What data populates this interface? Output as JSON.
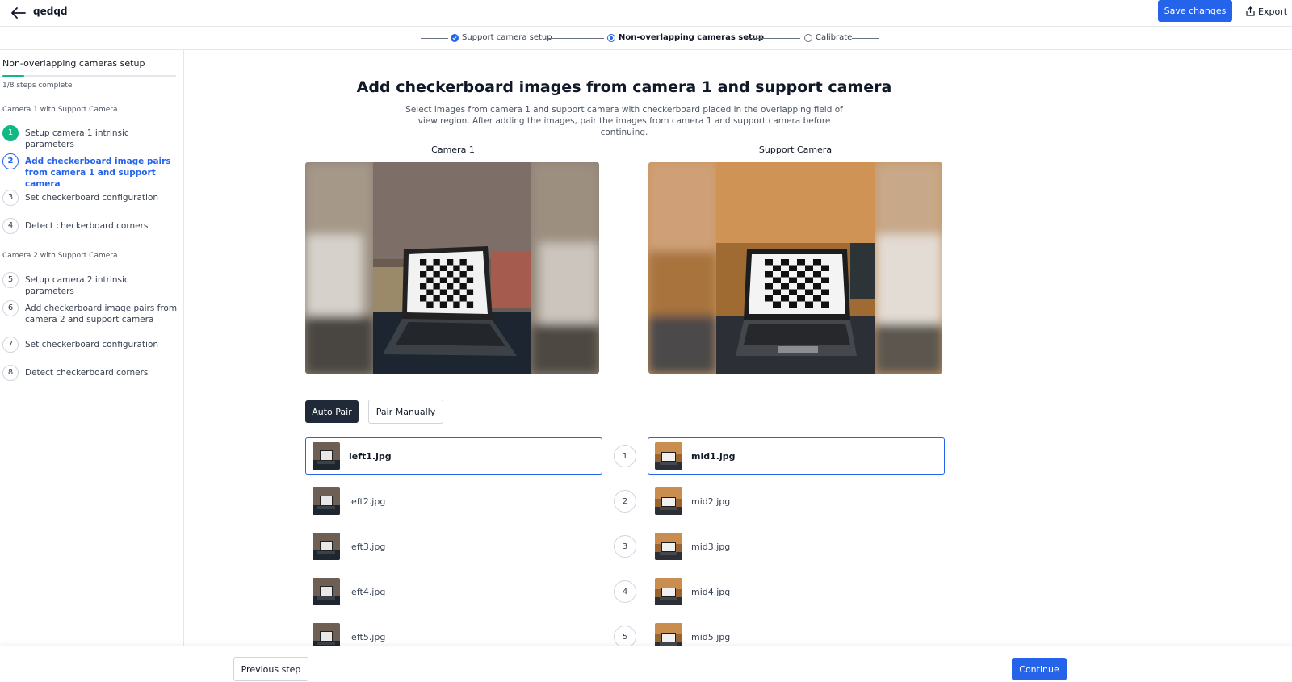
{
  "header": {
    "project_name": "qedqd",
    "save_label": "Save changes",
    "export_label": "Export"
  },
  "stepper": {
    "steps": [
      {
        "label": "Support camera setup",
        "state": "done"
      },
      {
        "label": "Non-overlapping cameras setup",
        "state": "current"
      },
      {
        "label": "Calibrate",
        "state": "todo"
      }
    ]
  },
  "sidebar": {
    "title": "Non-overlapping cameras setup",
    "progress_fraction": 0.125,
    "progress_text": "1/8 steps complete",
    "groups": [
      {
        "label": "Camera 1 with Support Camera",
        "steps": [
          {
            "num": "1",
            "label": "Setup camera 1 intrinsic parameters",
            "state": "done"
          },
          {
            "num": "2",
            "label": "Add checkerboard image pairs from camera 1 and support camera",
            "state": "current"
          },
          {
            "num": "3",
            "label": "Set checkerboard configuration",
            "state": "todo"
          },
          {
            "num": "4",
            "label": "Detect checkerboard corners",
            "state": "todo"
          }
        ]
      },
      {
        "label": "Camera 2 with Support Camera",
        "steps": [
          {
            "num": "5",
            "label": "Setup camera 2 intrinsic parameters",
            "state": "todo"
          },
          {
            "num": "6",
            "label": "Add checkerboard image pairs from camera 2 and support camera",
            "state": "todo"
          },
          {
            "num": "7",
            "label": "Set checkerboard configuration",
            "state": "todo"
          },
          {
            "num": "8",
            "label": "Detect checkerboard corners",
            "state": "todo"
          }
        ]
      }
    ]
  },
  "main": {
    "title": "Add checkerboard images from camera 1 and support camera",
    "description": "Select images from camera 1 and support camera with checkerboard placed in the overlapping field of view region. After adding the images, pair the images from camera 1 and support camera before continuing.",
    "camera1_label": "Camera 1",
    "support_label": "Support Camera",
    "auto_pair_label": "Auto Pair",
    "pair_manually_label": "Pair Manually",
    "pairs": [
      {
        "num": "1",
        "left": "left1.jpg",
        "right": "mid1.jpg",
        "selected": true
      },
      {
        "num": "2",
        "left": "left2.jpg",
        "right": "mid2.jpg",
        "selected": false
      },
      {
        "num": "3",
        "left": "left3.jpg",
        "right": "mid3.jpg",
        "selected": false
      },
      {
        "num": "4",
        "left": "left4.jpg",
        "right": "mid4.jpg",
        "selected": false
      },
      {
        "num": "5",
        "left": "left5.jpg",
        "right": "mid5.jpg",
        "selected": false
      }
    ]
  },
  "footer": {
    "previous_label": "Previous step",
    "continue_label": "Continue"
  },
  "colors": {
    "accent": "#2563eb",
    "success": "#10b981",
    "dark_button": "#1f2937"
  }
}
